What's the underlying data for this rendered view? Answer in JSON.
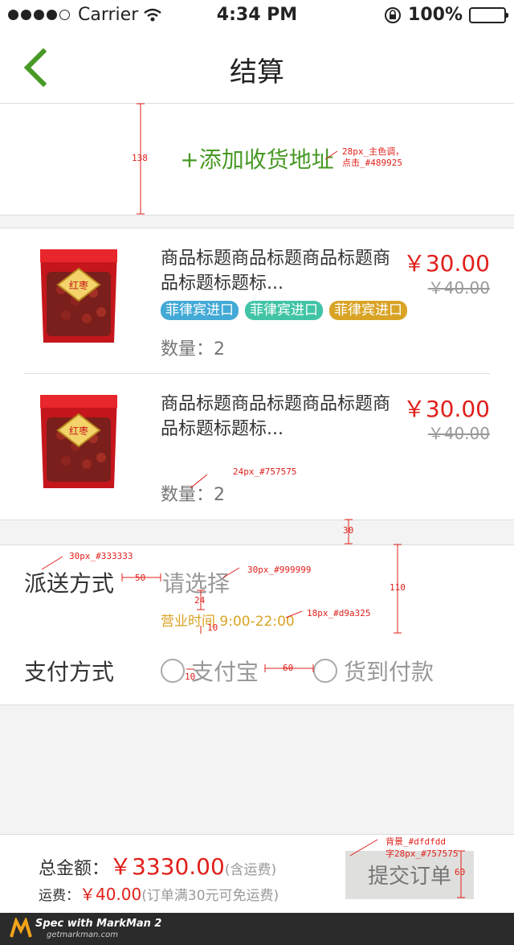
{
  "status_bar": {
    "carrier": "Carrier",
    "time": "4:34 PM",
    "battery": "100%"
  },
  "nav": {
    "title": "结算"
  },
  "address": {
    "add_label": "+添加收货地址"
  },
  "items": [
    {
      "title": "商品标题商品标题商品标题商品标题标题标...",
      "price": "￥30.00",
      "old_price": "￥40.00",
      "tags": [
        "菲律宾进口",
        "菲律宾进口",
        "菲律宾进口"
      ],
      "quantity": "数量：2",
      "image_label": "红枣"
    },
    {
      "title": "商品标题商品标题商品标题商品标题标题标...",
      "price": "￥30.00",
      "old_price": "￥40.00",
      "tags": [],
      "quantity": "数量：2",
      "image_label": "红枣"
    }
  ],
  "tag_colors": [
    "#43a9d6",
    "#41c4a6",
    "#d9a325"
  ],
  "delivery": {
    "label": "派送方式",
    "placeholder": "请选择",
    "hours": "营业时间 9:00-22:00"
  },
  "payment": {
    "label": "支付方式",
    "option_1": "支付宝",
    "option_2": "货到付款"
  },
  "footer": {
    "total_label": "总金额：",
    "total_amount": "￥3330.00",
    "total_note": "(含运费)",
    "shipping_label": "运费：",
    "shipping_amount": "￥40.00",
    "shipping_note": "(订单满30元可免运费)",
    "submit_label": "提交订单"
  },
  "annotations": {
    "address_height": "138",
    "address_note_1": "28px_主色调，",
    "address_note_2": "点击_#489925",
    "qty_note": "24px_#757575",
    "gap_30": "30",
    "delivery_label_note": "30px_#333333",
    "gap_50": "50",
    "placeholder_note": "30px_#999999",
    "gap_24": "24",
    "hours_note": "18px_#d9a325",
    "gap_10a": "10",
    "delivery_height": "110",
    "gap_10b": "10",
    "gap_60": "60",
    "submit_note_1": "背景_#dfdfdd",
    "submit_note_2": "字28px_#757575",
    "submit_height": "60"
  },
  "markman": {
    "title": "Spec with MarkMan 2",
    "site": "getmarkman.com"
  },
  "colors": {
    "primary": "#489925",
    "price_red": "#e0201b",
    "hours_gold": "#d9a325",
    "submit_bg": "#dfdfdd"
  }
}
